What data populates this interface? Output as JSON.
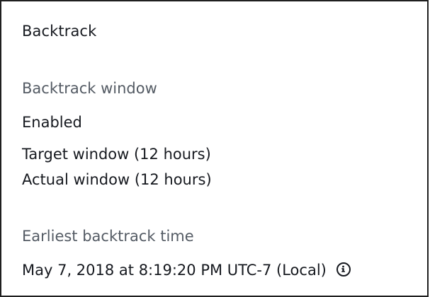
{
  "panel": {
    "title": "Backtrack",
    "backtrack_window": {
      "label": "Backtrack window",
      "status": "Enabled",
      "target": "Target window (12 hours)",
      "actual": "Actual window (12 hours)"
    },
    "earliest_time": {
      "label": "Earliest backtrack time",
      "value": "May 7, 2018 at 8:19:20 PM UTC-7 (Local)"
    }
  },
  "icons": {
    "info": "info-icon"
  }
}
